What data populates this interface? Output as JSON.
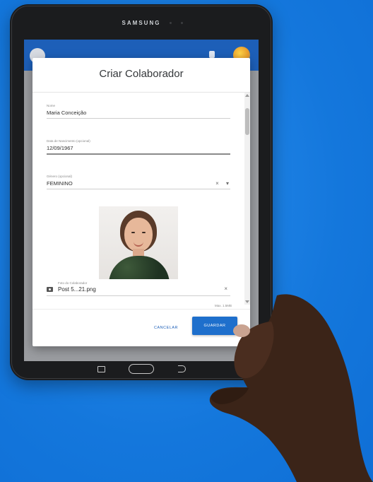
{
  "device": {
    "brand": "SAMSUNG"
  },
  "app": {
    "header_title": ""
  },
  "dialog": {
    "title": "Criar Colaborador",
    "fields": {
      "name": {
        "label": "Nome",
        "value": "Maria Conceição"
      },
      "birthdate": {
        "label": "Data de Nascimento (opcional)",
        "value": "12/09/1967"
      },
      "gender": {
        "label": "Género (opcional)",
        "value": "FEMININO"
      }
    },
    "photo_upload": {
      "label": "Foto do Colaborador",
      "filename": "Post 5...21.png",
      "max_size": "Max. 1.5MB"
    },
    "actions": {
      "cancel_label": "CANCELAR",
      "save_label": "GUARDAR"
    }
  },
  "colors": {
    "background": "#1a7fe0",
    "primary": "#1e6fcc",
    "appbar": "#1d5fb8"
  },
  "icons": {
    "clear": "×",
    "dropdown": "▾"
  }
}
